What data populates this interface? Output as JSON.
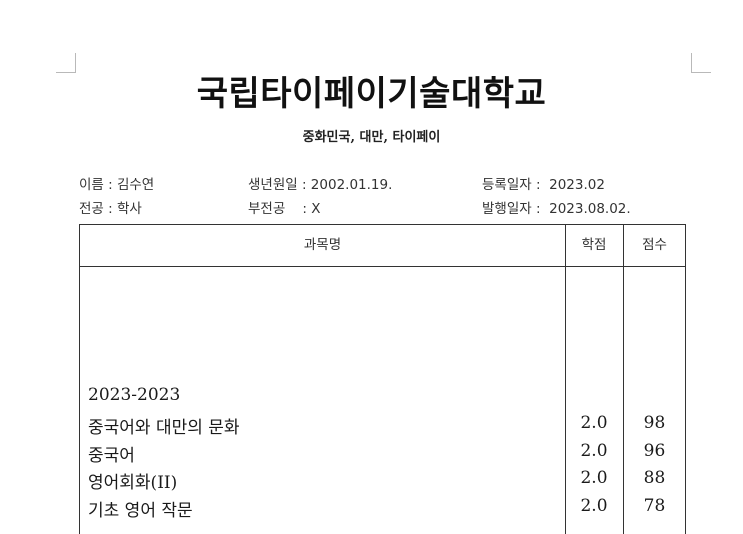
{
  "document": {
    "title": "국립타이페이기술대학교",
    "subtitle": "중화민국, 대만, 타이페이"
  },
  "student": {
    "name_label": "이름 : 김수연",
    "birth_label": "생년원일 : 2002.01.19.",
    "enroll_label": "등록일자 :  2023.02",
    "major_label": "전공 : 학사",
    "minor_label": "부전공    : X",
    "issue_label": "발행일자 :  2023.08.02."
  },
  "table": {
    "headers": {
      "subject": "과목명",
      "credit": "학점",
      "score": "점수"
    },
    "term": "2023-2023",
    "courses": [
      {
        "subject": "중국어와 대만의 문화",
        "credit": "2.0",
        "score": "98"
      },
      {
        "subject": "중국어",
        "credit": "2.0",
        "score": "96"
      },
      {
        "subject": "영어회화(II)",
        "credit": "2.0",
        "score": "88"
      },
      {
        "subject": "기초 영어 작문",
        "credit": "2.0",
        "score": "78"
      }
    ]
  }
}
